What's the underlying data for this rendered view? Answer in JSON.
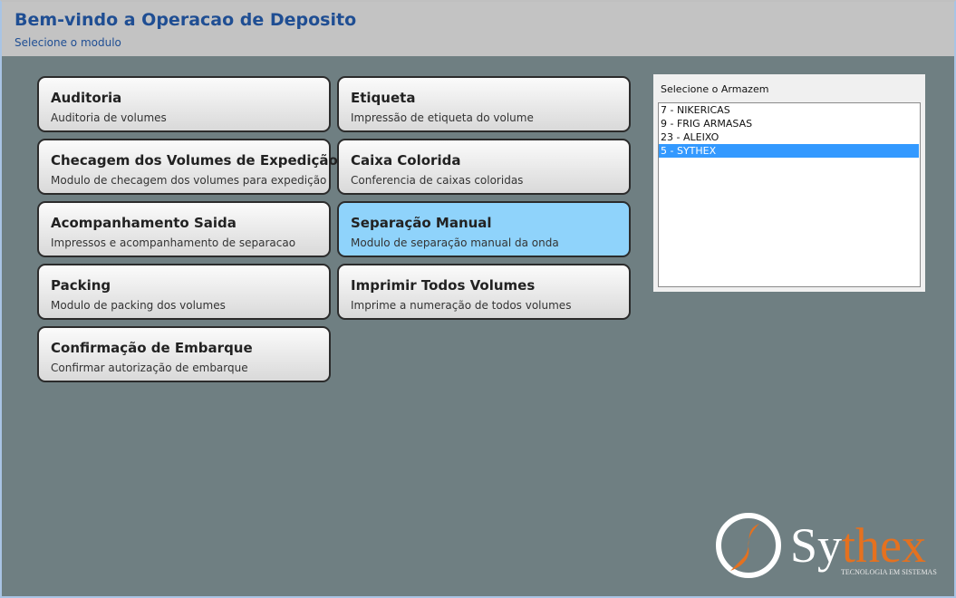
{
  "header": {
    "title": "Bem-vindo a Operacao de Deposito",
    "subtitle": "Selecione o modulo"
  },
  "modules": [
    {
      "name": "Auditoria",
      "description": "Auditoria de volumes"
    },
    {
      "name": "Etiqueta",
      "description": "Impressão de etiqueta do volume"
    },
    {
      "name": "Checagem dos Volumes de Expedição",
      "description": "Modulo de checagem dos volumes para expedição"
    },
    {
      "name": "Caixa Colorida",
      "description": "Conferencia de caixas coloridas"
    },
    {
      "name": "Acompanhamento Saida",
      "description": "Impressos e acompanhamento de separacao"
    },
    {
      "name": "Separação Manual",
      "description": "Modulo de separação manual da onda"
    },
    {
      "name": "Packing",
      "description": "Modulo de packing dos volumes"
    },
    {
      "name": "Imprimir Todos Volumes",
      "description": "Imprime a numeração de todos volumes"
    },
    {
      "name": "Confirmação de Embarque",
      "description": "Confirmar autorização de embarque"
    }
  ],
  "active_module": "Separação Manual",
  "warehouse": {
    "label": "Selecione o Armazem",
    "items": [
      "7 - NIKERICAS",
      "9 - FRIG ARMASAS",
      "23 - ALEIXO",
      "5 - SYTHEX"
    ],
    "selected": "5 - SYTHEX"
  },
  "logo": {
    "brand_prefix": "Sy",
    "brand_suffix": "thex",
    "tagline": "TECNOLOGIA EM SISTEMAS"
  },
  "colors": {
    "header_title": "#1f4e93",
    "active_module_bg": "#8fd3fb",
    "selection": "#3399ff",
    "logo_orange": "#e5711f"
  }
}
